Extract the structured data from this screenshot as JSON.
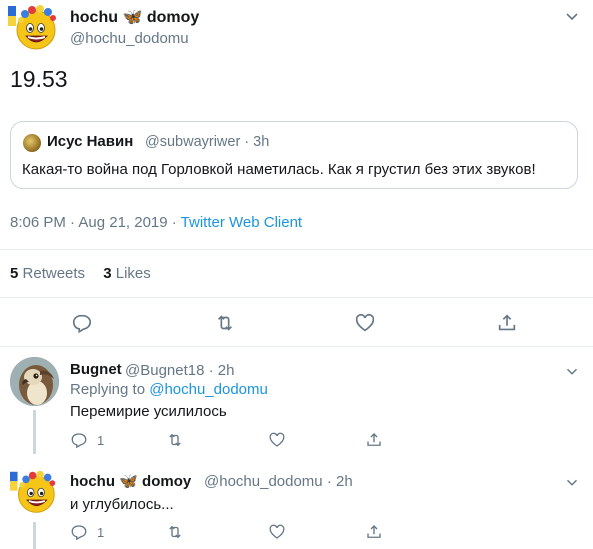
{
  "main_tweet": {
    "display_name_part1": "hochu",
    "display_name_emoji": "🦋",
    "display_name_part2": "domoy",
    "handle": "@hochu_dodomu",
    "text": "19.53",
    "timestamp": "8:06 PM · Aug 21, 2019 · ",
    "client": "Twitter Web Client",
    "stats": {
      "retweets_count": "5",
      "retweets_label": "Retweets",
      "likes_count": "3",
      "likes_label": "Likes"
    }
  },
  "quoted_tweet": {
    "display_name": "Исус Навин",
    "handle_time": "@subwayriwer · 3h",
    "text": "Какая-то война под Горловкой наметилась. Как я грустил без этих звуков!"
  },
  "replies": [
    {
      "display_name": "Bugnet",
      "handle_time": "@Bugnet18 · 2h",
      "replying_prefix": "Replying to ",
      "replying_handle": "@hochu_dodomu",
      "text": "Перемирие усилилось",
      "reply_count": "1"
    },
    {
      "display_name_part1": "hochu",
      "display_name_emoji": "🦋",
      "display_name_part2": "domoy",
      "handle_time": "@hochu_dodomu · 2h",
      "text": "и углубилось...",
      "reply_count": "1"
    }
  ],
  "icons": {
    "reply": "reply-icon",
    "retweet": "retweet-icon",
    "like": "heart-icon",
    "share": "share-icon",
    "caret": "chevron-down-icon"
  },
  "colors": {
    "accent": "#1b95e0",
    "muted": "#657786",
    "border": "#e6ecf0"
  }
}
